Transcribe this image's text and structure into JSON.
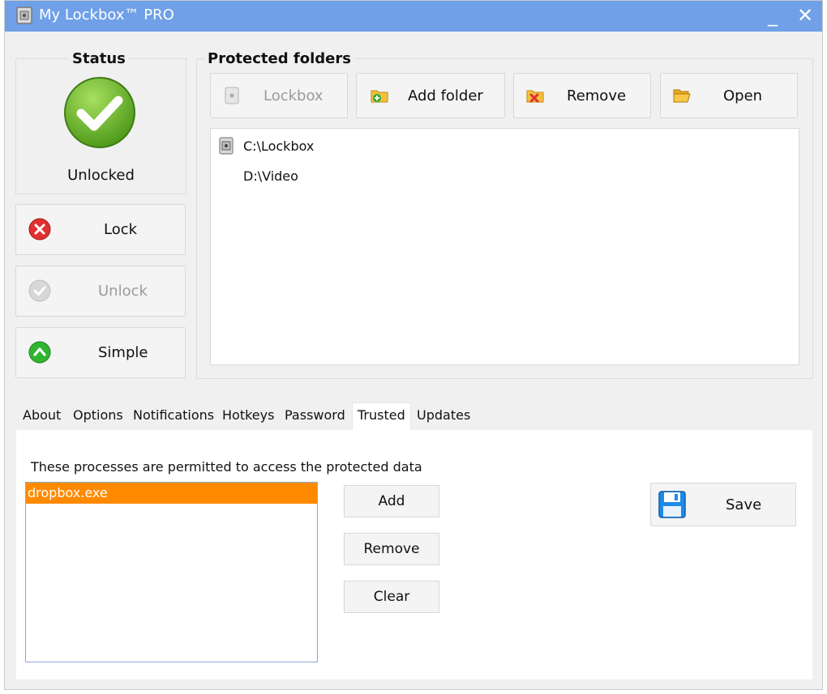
{
  "window": {
    "title": "My Lockbox™ PRO",
    "minimize": "_",
    "close": "✕"
  },
  "status": {
    "group_title": "Status",
    "state": "Unlocked",
    "lock_label": "Lock",
    "unlock_label": "Unlock",
    "simple_label": "Simple"
  },
  "protected": {
    "group_title": "Protected folders",
    "toolbar": {
      "lockbox_label": "Lockbox",
      "add_folder_label": "Add folder",
      "remove_label": "Remove",
      "open_label": "Open"
    },
    "folders": [
      "C:\\Lockbox",
      "D:\\Video"
    ]
  },
  "tabs": [
    "About",
    "Options",
    "Notifications",
    "Hotkeys",
    "Password",
    "Trusted",
    "Updates"
  ],
  "active_tab": "Trusted",
  "trusted": {
    "description": "These processes are permitted to access the protected data",
    "processes": [
      "dropbox.exe"
    ],
    "add_label": "Add",
    "remove_label": "Remove",
    "clear_label": "Clear",
    "save_label": "Save"
  },
  "colors": {
    "titlebar": "#6fa0e8",
    "selection": "#ff8a00",
    "status_ok": "#6cb22a",
    "lock_red": "#e03030",
    "simple_green": "#2fb52f"
  }
}
